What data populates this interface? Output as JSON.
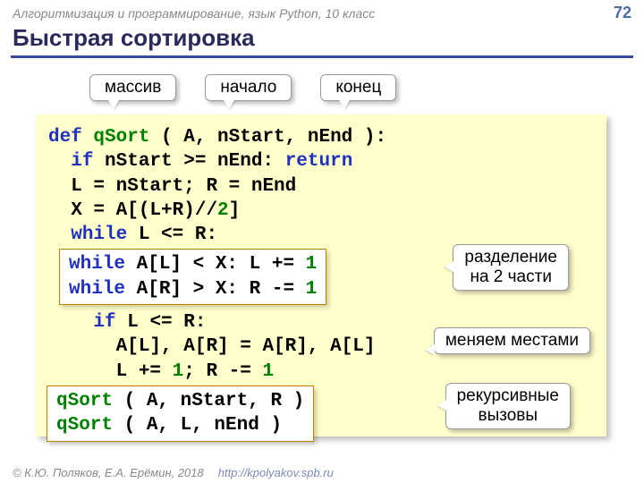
{
  "header": {
    "breadcrumb": "Алгоритмизация и программирование, язык Python, 10 класс",
    "slide_number": "72"
  },
  "title": "Быстрая сортировка",
  "top_labels": {
    "array": "массив",
    "start": "начало",
    "end": "конец"
  },
  "side_labels": {
    "split": "разделение\nна 2 части",
    "swap": "меняем местами",
    "recurse": "рекурсивные\nвызовы"
  },
  "code": {
    "def": "def",
    "fn_name": "qSort",
    "sig_rest": " ( A, nStart, nEnd ):",
    "if1a": "if",
    "if1b": " nStart >= nEnd: ",
    "return": "return",
    "l3": "L = nStart; R = nEnd",
    "l4a": "X = A[(L+R)//",
    "two": "2",
    "l4b": "]",
    "while1": "while",
    "while1b": " L <= R:",
    "inner1a": "while",
    "inner1b": " A[L] < X: L += ",
    "one_a": "1",
    "inner2a": "while",
    "inner2b": " A[R] > X: R -= ",
    "one_b": "1",
    "if2a": "if",
    "if2b": " L <= R:",
    "swap": "A[L], A[R] = A[R], A[L]",
    "incdec_a": "L += ",
    "one_c": "1",
    "incdec_b": "; R -= ",
    "one_d": "1",
    "rec1": " ( A, nStart, R )",
    "rec2": " ( A, L, nEnd )"
  },
  "footer": {
    "copyright": "© К.Ю. Поляков, Е.А. Ерёмин, 2018",
    "url": "http://kpolyakov.spb.ru"
  }
}
